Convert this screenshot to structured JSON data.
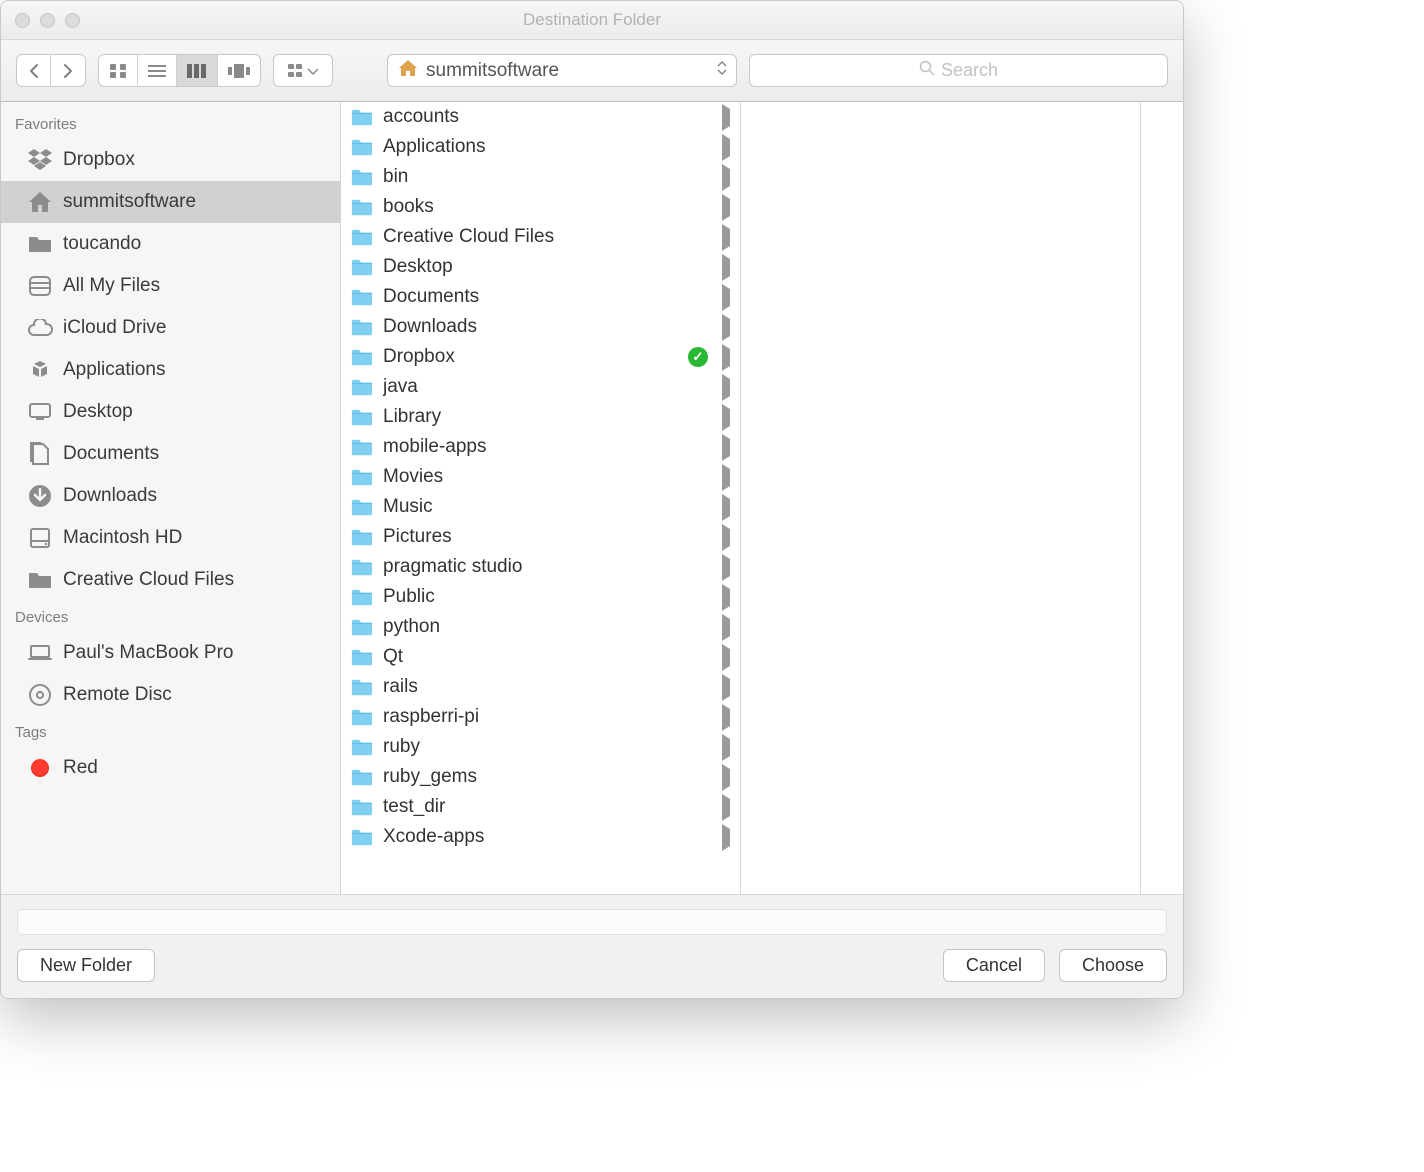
{
  "window": {
    "title": "Destination Folder"
  },
  "toolbar": {
    "path_label": "summitsoftware",
    "search_placeholder": "Search"
  },
  "sidebar": {
    "sections": [
      {
        "title": "Favorites",
        "items": [
          {
            "label": "Dropbox",
            "icon": "dropbox"
          },
          {
            "label": "summitsoftware",
            "icon": "home",
            "selected": true
          },
          {
            "label": "toucando",
            "icon": "folder"
          },
          {
            "label": "All My Files",
            "icon": "allfiles"
          },
          {
            "label": "iCloud Drive",
            "icon": "cloud"
          },
          {
            "label": "Applications",
            "icon": "apps"
          },
          {
            "label": "Desktop",
            "icon": "desktop"
          },
          {
            "label": "Documents",
            "icon": "documents"
          },
          {
            "label": "Downloads",
            "icon": "downloads"
          },
          {
            "label": "Macintosh HD",
            "icon": "hdd"
          },
          {
            "label": "Creative Cloud Files",
            "icon": "folder"
          }
        ]
      },
      {
        "title": "Devices",
        "items": [
          {
            "label": "Paul's MacBook Pro",
            "icon": "laptop"
          },
          {
            "label": "Remote Disc",
            "icon": "disc"
          }
        ]
      },
      {
        "title": "Tags",
        "items": [
          {
            "label": "Red",
            "icon": "tag-red"
          }
        ]
      }
    ]
  },
  "column": {
    "items": [
      {
        "name": "accounts",
        "icon": "folder"
      },
      {
        "name": "Applications",
        "icon": "appfolder"
      },
      {
        "name": "bin",
        "icon": "folder"
      },
      {
        "name": "books",
        "icon": "folder"
      },
      {
        "name": "Creative Cloud Files",
        "icon": "folder"
      },
      {
        "name": "Desktop",
        "icon": "folder"
      },
      {
        "name": "Documents",
        "icon": "folder"
      },
      {
        "name": "Downloads",
        "icon": "folder"
      },
      {
        "name": "Dropbox",
        "icon": "dropboxfolder",
        "synced": true
      },
      {
        "name": "java",
        "icon": "folder"
      },
      {
        "name": "Library",
        "icon": "libfolder"
      },
      {
        "name": "mobile-apps",
        "icon": "folder"
      },
      {
        "name": "Movies",
        "icon": "folder"
      },
      {
        "name": "Music",
        "icon": "folder"
      },
      {
        "name": "Pictures",
        "icon": "folder"
      },
      {
        "name": "pragmatic studio",
        "icon": "folder"
      },
      {
        "name": "Public",
        "icon": "folder"
      },
      {
        "name": "python",
        "icon": "folder"
      },
      {
        "name": "Qt",
        "icon": "folder"
      },
      {
        "name": "rails",
        "icon": "folder"
      },
      {
        "name": "raspberri-pi",
        "icon": "folder"
      },
      {
        "name": "ruby",
        "icon": "folder"
      },
      {
        "name": "ruby_gems",
        "icon": "folder"
      },
      {
        "name": "test_dir",
        "icon": "folder"
      },
      {
        "name": "Xcode-apps",
        "icon": "folder"
      }
    ]
  },
  "buttons": {
    "new_folder": "New Folder",
    "cancel": "Cancel",
    "choose": "Choose"
  }
}
